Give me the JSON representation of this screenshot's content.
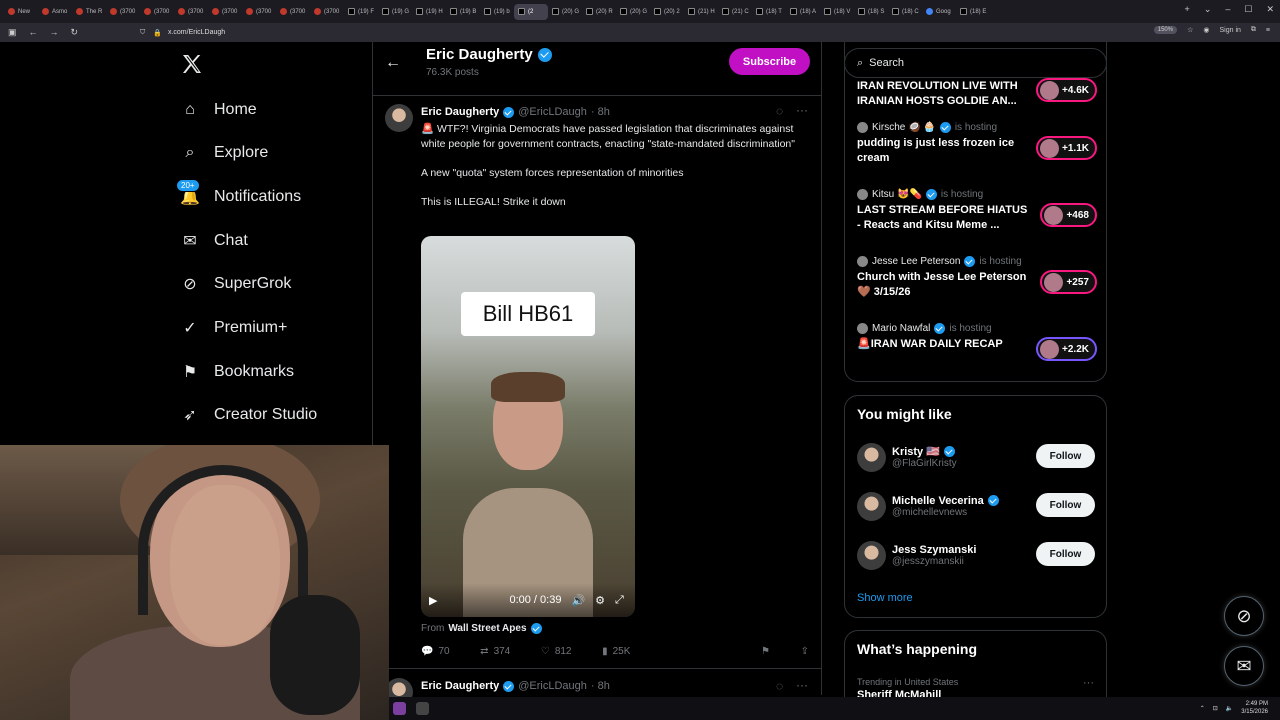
{
  "browser": {
    "tabs": [
      {
        "label": "New",
        "icon": "firefox-icon"
      },
      {
        "label": "Asmo",
        "icon": "site-icon"
      },
      {
        "label": "The R",
        "icon": "site-icon"
      },
      {
        "label": "(3700",
        "icon": "youtube-icon"
      },
      {
        "label": "(3700",
        "icon": "youtube-icon"
      },
      {
        "label": "(3700",
        "icon": "youtube-icon"
      },
      {
        "label": "(3700",
        "icon": "youtube-icon"
      },
      {
        "label": "(3700",
        "icon": "youtube-icon"
      },
      {
        "label": "(3700",
        "icon": "youtube-icon"
      },
      {
        "label": "(3700",
        "icon": "youtube-icon"
      },
      {
        "label": "(19) F",
        "icon": "x-icon"
      },
      {
        "label": "(19) G",
        "icon": "x-icon"
      },
      {
        "label": "(19) H",
        "icon": "x-icon"
      },
      {
        "label": "(19) B",
        "icon": "x-icon"
      },
      {
        "label": "(19) b",
        "icon": "x-icon"
      },
      {
        "label": "(2",
        "icon": "x-icon",
        "active": true
      },
      {
        "label": "(20) G",
        "icon": "x-icon"
      },
      {
        "label": "(20) R",
        "icon": "x-icon"
      },
      {
        "label": "(20) G",
        "icon": "x-icon"
      },
      {
        "label": "(20) 2",
        "icon": "x-icon"
      },
      {
        "label": "(21) H",
        "icon": "x-icon"
      },
      {
        "label": "(21) C",
        "icon": "x-icon"
      },
      {
        "label": "(18) T",
        "icon": "x-icon"
      },
      {
        "label": "(18) A",
        "icon": "x-icon"
      },
      {
        "label": "(18) V",
        "icon": "x-icon"
      },
      {
        "label": "(18) S",
        "icon": "x-icon"
      },
      {
        "label": "(18) C",
        "icon": "x-icon"
      },
      {
        "label": "Goog",
        "icon": "google-icon"
      },
      {
        "label": "(18) E",
        "icon": "x-icon"
      }
    ],
    "url": "x.com/EricLDaugh",
    "zoom": "150%",
    "sign_in": "Sign in"
  },
  "nav": {
    "items": [
      {
        "label": "Home",
        "icon": "home-icon"
      },
      {
        "label": "Explore",
        "icon": "search-icon"
      },
      {
        "label": "Notifications",
        "icon": "bell-icon",
        "badge": "20+"
      },
      {
        "label": "Chat",
        "icon": "mail-icon"
      },
      {
        "label": "SuperGrok",
        "icon": "grok-icon"
      },
      {
        "label": "Premium+",
        "icon": "verified-badge-icon"
      },
      {
        "label": "Bookmarks",
        "icon": "bookmark-icon"
      },
      {
        "label": "Creator Studio",
        "icon": "rocket-icon"
      }
    ]
  },
  "header": {
    "name": "Eric Daugherty",
    "posts": "76.3K posts",
    "subscribe": "Subscribe"
  },
  "tweet": {
    "name": "Eric Daugherty",
    "handle": "@EricLDaugh",
    "time": "· 8h",
    "text1": "🚨 WTF?! Virginia Democrats have passed legislation that discriminates against white people for government contracts, enacting \"state-mandated discrimination\"",
    "text2": "A new \"quota\" system forces representation of minorities",
    "text3": "This is ILLEGAL! Strike it down",
    "video_caption": "Bill HB61",
    "video_time": "0:00 / 0:39",
    "from_label": "From",
    "from_name": "Wall Street Apes",
    "replies": "70",
    "reposts": "374",
    "likes": "812",
    "views": "25K"
  },
  "next_tweet": {
    "name": "Eric Daugherty",
    "handle": "@EricLDaugh",
    "time": "· 8h"
  },
  "search": {
    "placeholder": "Search"
  },
  "spaces": [
    {
      "host": "",
      "hosting": "",
      "title": "IRAN REVOLUTION LIVE WITH IRANIAN HOSTS GOLDIE AN...",
      "count": "+4.6K"
    },
    {
      "host": "Kirsche 🥥 🧁",
      "hosting": "is hosting",
      "title": "pudding is just less frozen ice cream",
      "count": "+1.1K"
    },
    {
      "host": "Kitsu 😻💊",
      "hosting": "is hosting",
      "title": "LAST STREAM BEFORE HIATUS - Reacts and Kitsu Meme ...",
      "count": "+468"
    },
    {
      "host": "Jesse Lee Peterson",
      "hosting": "is hosting",
      "title": "Church with Jesse Lee Peterson 🤎 3/15/26",
      "count": "+257"
    },
    {
      "host": "Mario Nawfal",
      "hosting": "is hosting",
      "title": "🚨IRAN WAR DAILY RECAP",
      "count": "+2.2K"
    }
  ],
  "you_might_like": {
    "title": "You might like",
    "users": [
      {
        "name": "Kristy 🇺🇸",
        "handle": "@FlaGirlKristy",
        "follow": "Follow"
      },
      {
        "name": "Michelle Vecerina",
        "handle": "@michellevnews",
        "follow": "Follow"
      },
      {
        "name": "Jess Szymanski",
        "handle": "@jesszymanskii",
        "follow": "Follow"
      }
    ],
    "show_more": "Show more"
  },
  "happening": {
    "title": "What’s happening",
    "category": "Trending in United States",
    "trend": "Sheriff McMahill"
  },
  "taskbar": {
    "time": "2:49 PM",
    "date": "3/15/2026"
  },
  "colors": {
    "accent": "#1d9bf0",
    "subscribe": "#c10fc4",
    "space_ring": "#f91880"
  }
}
